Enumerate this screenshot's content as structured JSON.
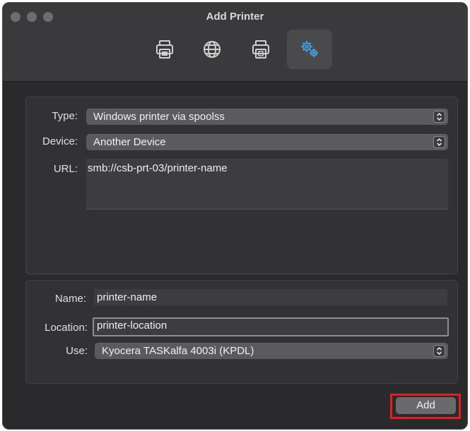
{
  "window": {
    "title": "Add Printer"
  },
  "toolbar": {
    "items": [
      {
        "name": "default-printers-tab",
        "icon": "printer-icon",
        "active": false
      },
      {
        "name": "ip-printers-tab",
        "icon": "globe-icon",
        "active": false
      },
      {
        "name": "windows-printers-tab",
        "icon": "windows-printer-icon",
        "active": false
      },
      {
        "name": "advanced-tab",
        "icon": "gears-icon",
        "active": true
      }
    ]
  },
  "connection": {
    "type_label": "Type:",
    "type_value": "Windows printer via spoolss",
    "device_label": "Device:",
    "device_value": "Another Device",
    "url_label": "URL:",
    "url_value": "smb://csb-prt-03/printer-name"
  },
  "details": {
    "name_label": "Name:",
    "name_value": "printer-name",
    "location_label": "Location:",
    "location_value": "printer-location",
    "use_label": "Use:",
    "use_value": "Kyocera TASKalfa 4003i (KPDL)"
  },
  "actions": {
    "add_label": "Add"
  },
  "colors": {
    "accent": "#3ea6e6",
    "highlight": "#e02020",
    "window_bg": "#2a2a2c"
  }
}
